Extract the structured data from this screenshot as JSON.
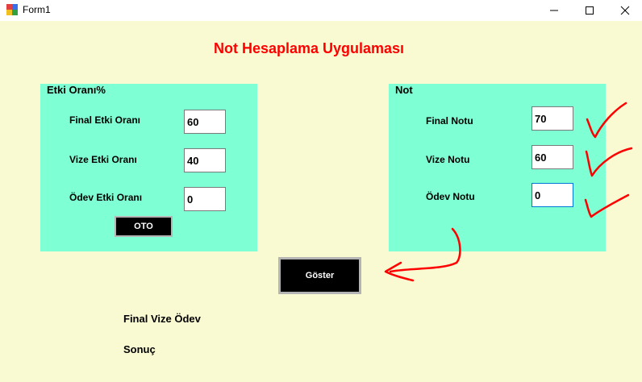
{
  "window": {
    "title": "Form1",
    "min_glyph": "—",
    "max_glyph": "☐",
    "close_glyph": "✕"
  },
  "heading": "Not Hesaplama Uygulaması",
  "weights": {
    "caption": "Etki Oranı%",
    "final_label": "Final Etki Oranı",
    "final_value": "60",
    "midterm_label": "Vize Etki Oranı",
    "midterm_value": "40",
    "homework_label": "Ödev Etki Oranı",
    "homework_value": "0",
    "auto_button": "OTO"
  },
  "grades": {
    "caption": "Not",
    "final_label": "Final Notu",
    "final_value": "70",
    "midterm_label": "Vize Notu",
    "midterm_value": "60",
    "homework_label": "Ödev Notu",
    "homework_value": "0"
  },
  "show_button": "Göster",
  "results": {
    "summary_label": "Final Vize Ödev",
    "result_label": "Sonuç"
  },
  "colors": {
    "background": "#fafad2",
    "panel": "#7fffd4",
    "heading": "#ff0000",
    "annotation": "#ff0000"
  }
}
